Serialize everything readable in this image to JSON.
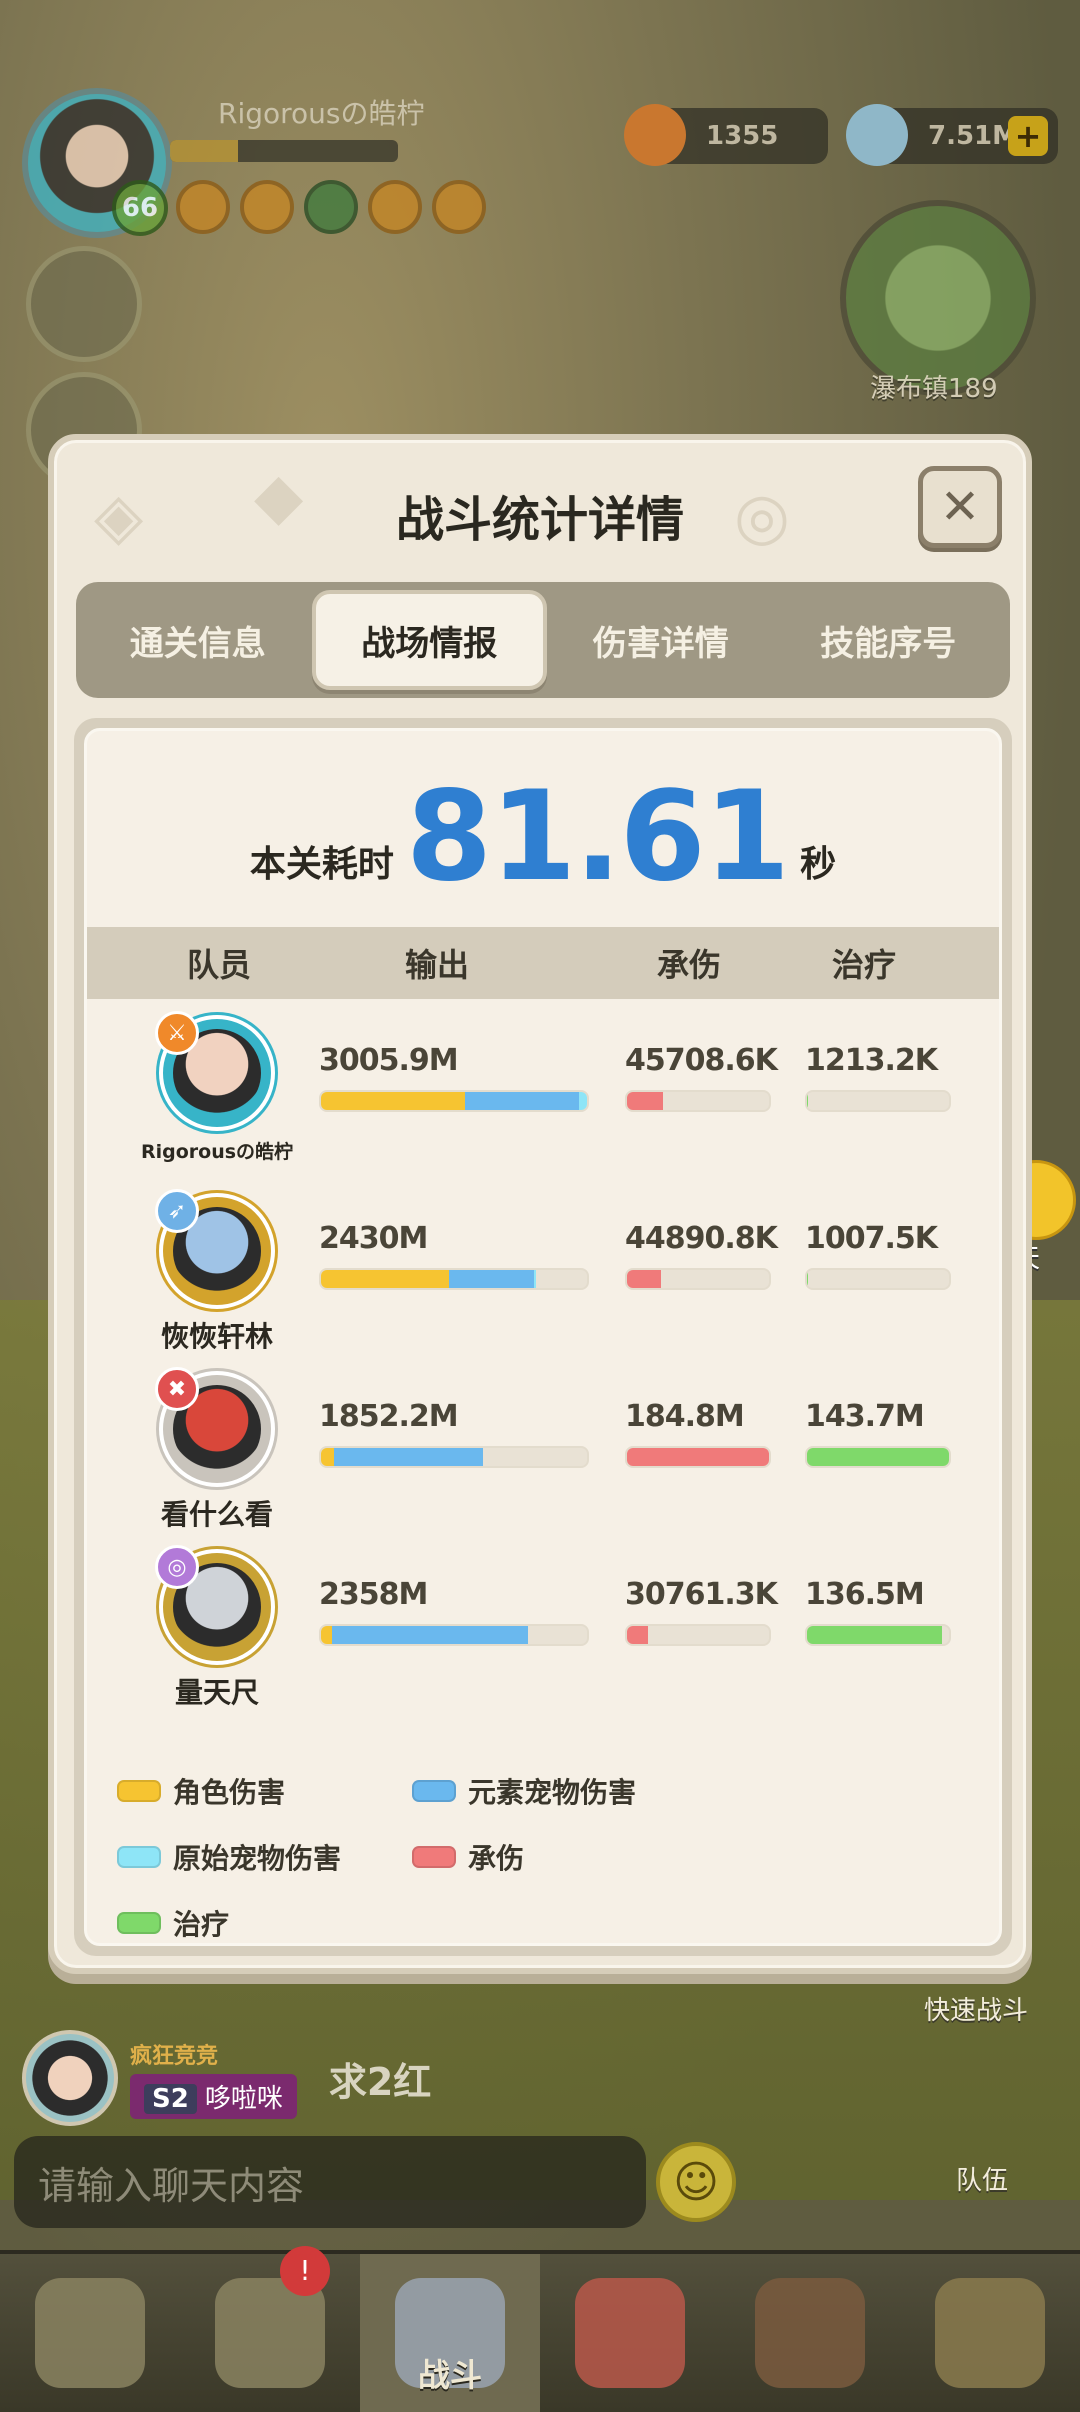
{
  "hud": {
    "player_name": "Rigorousの皓柠",
    "level": "66",
    "gold": "1355",
    "diamonds": "7.51M",
    "plus_label": "+",
    "location": "瀑布镇189"
  },
  "side_buttons": {
    "chat": "聊天",
    "quick_battle": "快速战斗",
    "team": "队伍"
  },
  "chat": {
    "title_tag": "疯狂竞竞",
    "season": "S2",
    "user_tag": "哆啦咪",
    "message": "求2红",
    "input_placeholder": "请输入聊天内容"
  },
  "bottom_nav": {
    "battle_label": "战斗"
  },
  "modal": {
    "title": "战斗统计详情",
    "close_label": "✕",
    "tabs": [
      {
        "label": "通关信息",
        "active": false
      },
      {
        "label": "战场情报",
        "active": true
      },
      {
        "label": "伤害详情",
        "active": false
      },
      {
        "label": "技能序号",
        "active": false
      }
    ],
    "time_label": "本关耗时",
    "time_value": "81.61",
    "time_unit": "秒",
    "columns": {
      "member": "队员",
      "output": "输出",
      "damage_taken": "承伤",
      "healing": "治疗"
    },
    "members": [
      {
        "name": "Rigorousの皓柠",
        "output": "3005.9M",
        "output_fraction": {
          "character": 0.54,
          "element_pet": 0.43,
          "primal_pet": 0.03
        },
        "damage_taken": "45708.6K",
        "damage_taken_fraction": 0.25,
        "healing": "1213.2K",
        "healing_fraction": 0.01
      },
      {
        "name": "恢恢轩林",
        "output": "2430M",
        "output_fraction": {
          "character": 0.48,
          "element_pet": 0.32,
          "primal_pet": 0.01
        },
        "damage_taken": "44890.8K",
        "damage_taken_fraction": 0.24,
        "healing": "1007.5K",
        "healing_fraction": 0.01
      },
      {
        "name": "看什么看",
        "output": "1852.2M",
        "output_fraction": {
          "character": 0.05,
          "element_pet": 0.56,
          "primal_pet": 0.0
        },
        "damage_taken": "184.8M",
        "damage_taken_fraction": 1.0,
        "healing": "143.7M",
        "healing_fraction": 1.0
      },
      {
        "name": "量天尺",
        "output": "2358M",
        "output_fraction": {
          "character": 0.04,
          "element_pet": 0.74,
          "primal_pet": 0.0
        },
        "damage_taken": "30761.3K",
        "damage_taken_fraction": 0.15,
        "healing": "136.5M",
        "healing_fraction": 0.95
      }
    ],
    "legend": [
      {
        "label": "角色伤害",
        "color": "#f6c431"
      },
      {
        "label": "元素宠物伤害",
        "color": "#6ab8ee"
      },
      {
        "label": "原始宠物伤害",
        "color": "#8ee5f7"
      },
      {
        "label": "承伤",
        "color": "#f07a7a"
      },
      {
        "label": "治疗",
        "color": "#7fd96a"
      }
    ]
  }
}
